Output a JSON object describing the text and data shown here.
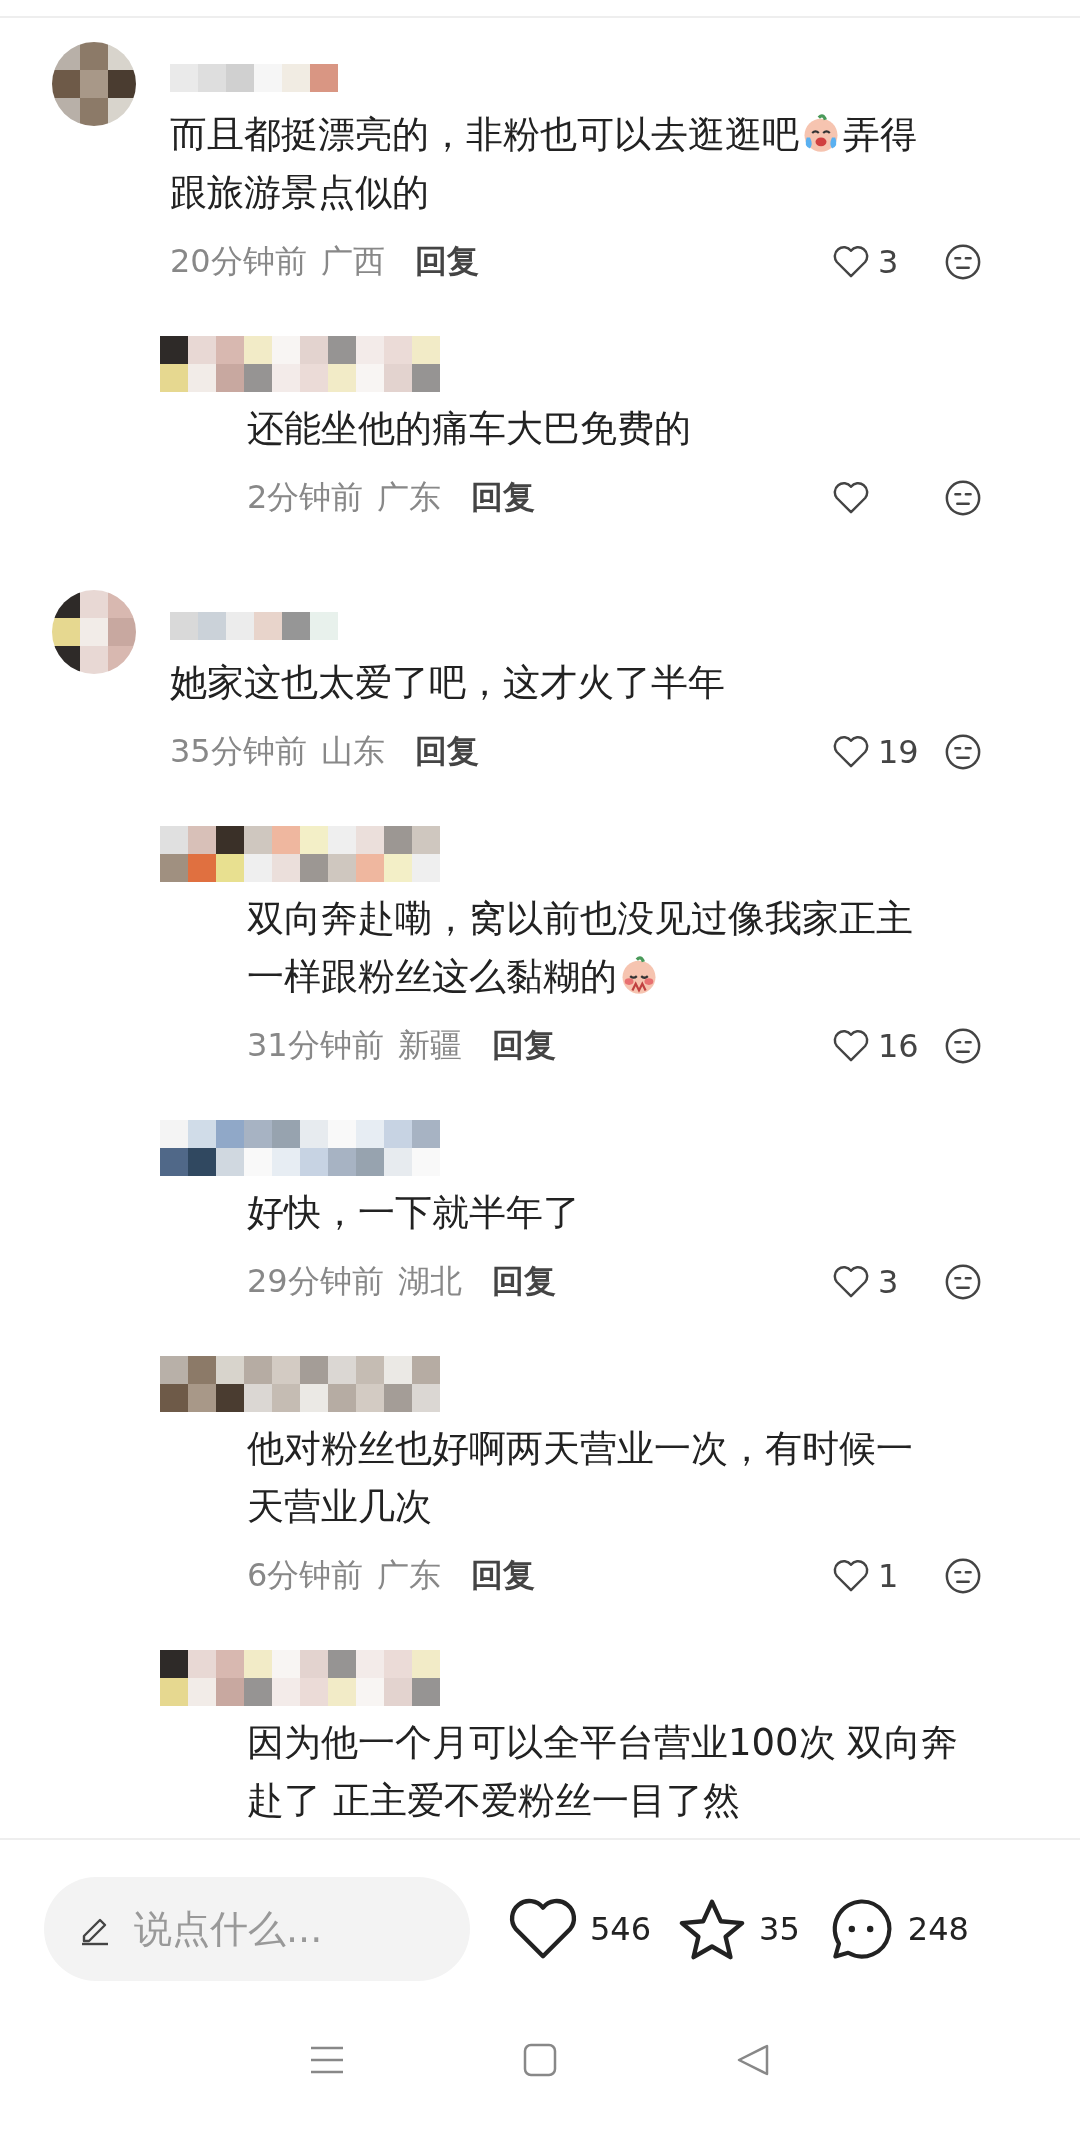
{
  "comments": [
    {
      "lines": [
        [
          {
            "kind": "text",
            "text": "而且都挺漂亮的，非粉也可以去逛逛吧"
          },
          {
            "kind": "crying"
          },
          {
            "kind": "text",
            "text": "弄得"
          }
        ],
        [
          {
            "kind": "text",
            "text": "跟旅游景点似的"
          }
        ]
      ],
      "time": "20分钟前",
      "location": "广西",
      "reply": "回复",
      "likes": "3",
      "replies": [
        {
          "lines": [
            [
              {
                "kind": "text",
                "text": "还能坐他的痛车大巴免费的"
              }
            ]
          ],
          "time": "2分钟前",
          "location": "广东",
          "reply": "回复"
        }
      ]
    },
    {
      "lines": [
        [
          {
            "kind": "text",
            "text": "她家这也太爱了吧，这才火了半年"
          }
        ]
      ],
      "time": "35分钟前",
      "location": "山东",
      "reply": "回复",
      "likes": "19",
      "replies": [
        {
          "lines": [
            [
              {
                "kind": "text",
                "text": "双向奔赴嘞，窝以前也没见过像我家正主"
              }
            ],
            [
              {
                "kind": "text",
                "text": "一样跟粉丝这么黏糊的"
              },
              {
                "kind": "shy"
              }
            ]
          ],
          "time": "31分钟前",
          "location": "新疆",
          "reply": "回复",
          "likes": "16"
        },
        {
          "lines": [
            [
              {
                "kind": "text",
                "text": "好快，一下就半年了"
              }
            ]
          ],
          "time": "29分钟前",
          "location": "湖北",
          "reply": "回复",
          "likes": "3"
        },
        {
          "lines": [
            [
              {
                "kind": "text",
                "text": "他对粉丝也好啊两天营业一次，有时候一"
              }
            ],
            [
              {
                "kind": "text",
                "text": "天营业几次"
              }
            ]
          ],
          "time": "6分钟前",
          "location": "广东",
          "reply": "回复",
          "likes": "1"
        },
        {
          "lines": [
            [
              {
                "kind": "text",
                "text": "因为他一个月可以全平台营业100次 双向奔"
              }
            ],
            [
              {
                "kind": "text",
                "text": "赴了 正主爱不爱粉丝一目了然"
              }
            ]
          ]
        }
      ]
    }
  ],
  "bottom_bar": {
    "placeholder": "说点什么...",
    "likes": "546",
    "favorites": "35",
    "comments": "248"
  }
}
